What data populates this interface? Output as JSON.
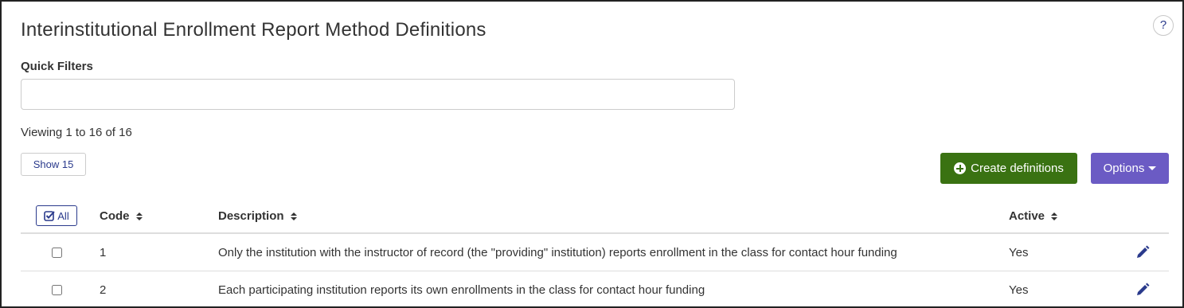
{
  "page": {
    "title": "Interinstitutional Enrollment Report Method Definitions",
    "help_label": "?"
  },
  "filters": {
    "label": "Quick Filters",
    "value": "",
    "placeholder": ""
  },
  "summary": {
    "viewing_text": "Viewing 1 to 16 of 16"
  },
  "toolbar": {
    "show_label": "Show 15",
    "create_label": "Create definitions",
    "options_label": "Options",
    "create_color": "#3a7212",
    "options_color": "#6b5bc4"
  },
  "table": {
    "select_all_label": "All",
    "columns": {
      "code": "Code",
      "description": "Description",
      "active": "Active"
    },
    "rows": [
      {
        "code": "1",
        "description": "Only the institution with the instructor of record (the \"providing\" institution) reports enrollment in the class for contact hour funding",
        "active": "Yes"
      },
      {
        "code": "2",
        "description": "Each participating institution reports its own enrollments in the class for contact hour funding",
        "active": "Yes"
      }
    ]
  },
  "icons": {
    "help": "question-icon",
    "create": "plus-circle-icon",
    "options": "caret-down-icon",
    "select_all": "check-square-icon",
    "sort": "sort-icon",
    "edit": "pencil-icon"
  }
}
